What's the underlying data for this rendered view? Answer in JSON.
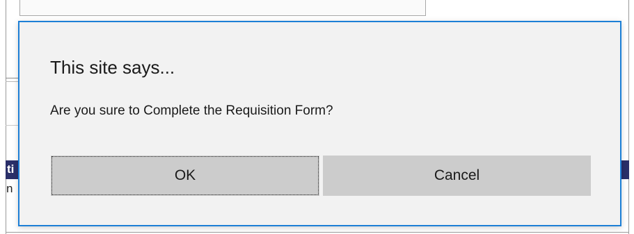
{
  "background": {
    "partial_header_text": "ti",
    "partial_row_text": "n"
  },
  "dialog": {
    "title": "This site says...",
    "message": "Are you sure to Complete the Requisition Form?",
    "ok_label": "OK",
    "cancel_label": "Cancel",
    "accent_color": "#1c7fd6",
    "button_color": "#cccccc"
  }
}
